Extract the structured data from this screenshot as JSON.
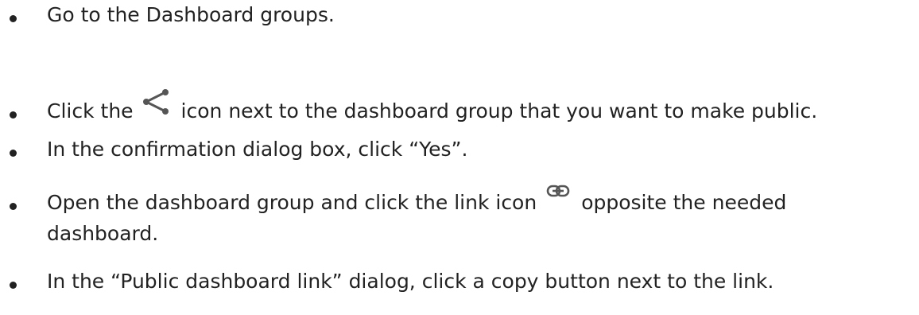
{
  "steps": [
    {
      "text": "Go to the Dashboard groups."
    },
    {
      "before_icon": "Click the",
      "icon": "share-icon",
      "after_icon": "icon next to the dashboard group that you want to make public."
    },
    {
      "text": "In the confirmation dialog box, click “Yes”."
    },
    {
      "before_icon": "Open the dashboard group and click the link icon",
      "icon": "link-icon",
      "after_icon": "opposite the needed",
      "continuation": "dashboard."
    },
    {
      "text": "In the “Public dashboard link” dialog, click a copy button next to the link."
    }
  ],
  "colors": {
    "text": "#222222",
    "icon": "#555555"
  }
}
